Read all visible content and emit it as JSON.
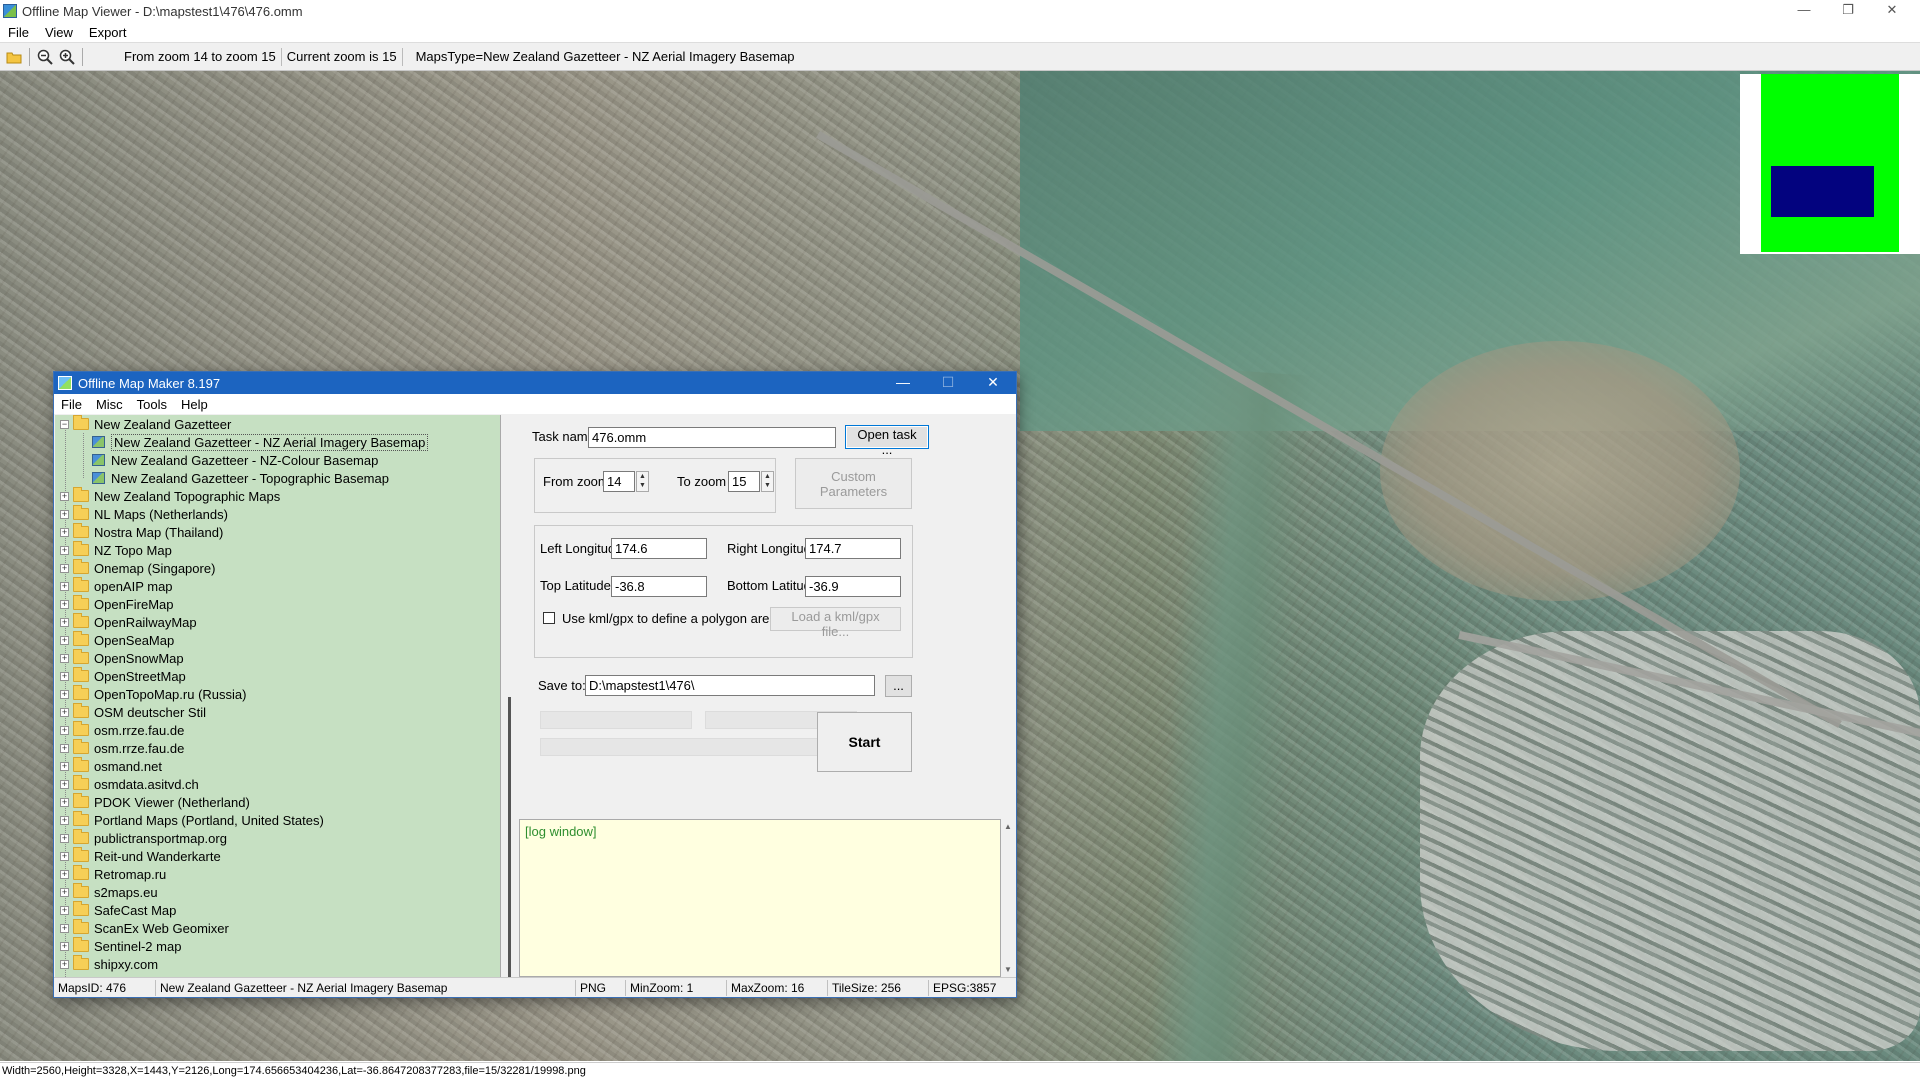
{
  "window": {
    "title": "Offline Map Viewer - D:\\mapstest1\\476\\476.omm",
    "controls": {
      "minimize": "—",
      "maximize": "❐",
      "close": "✕"
    }
  },
  "menu": [
    "File",
    "View",
    "Export"
  ],
  "toolbar": {
    "zoom_range": "From zoom 14 to zoom 15",
    "current_zoom": "Current zoom is 15",
    "maps_type": "MapsType=New Zealand Gazetteer - NZ Aerial Imagery Basemap",
    "icons": [
      "open-folder-icon",
      "zoom-out-icon",
      "zoom-in-icon"
    ]
  },
  "map": {
    "overview_colors": {
      "frame": "#00ff00",
      "viewport": "#03037f"
    }
  },
  "status_strip": "Width=2560,Height=3328,X=1443,Y=2126,Long=174.656653404236,Lat=-36.8647208377283,file=15/32281/19998.png",
  "dialog": {
    "title": "Offline Map Maker 8.197",
    "controls": {
      "minimize": "—",
      "maximize": "☐",
      "close": "✕"
    },
    "menu": [
      "File",
      "Misc",
      "Tools",
      "Help"
    ],
    "tree": {
      "root": "New Zealand Gazetteer",
      "children": [
        "New Zealand Gazetteer - NZ Aerial Imagery Basemap",
        "New Zealand Gazetteer - NZ-Colour Basemap",
        "New Zealand Gazetteer - Topographic Basemap"
      ],
      "selected_index": 0,
      "folders": [
        "New Zealand Topographic Maps",
        "NL Maps (Netherlands)",
        "Nostra Map (Thailand)",
        "NZ Topo Map",
        "Onemap (Singapore)",
        "openAIP map",
        "OpenFireMap",
        "OpenRailwayMap",
        "OpenSeaMap",
        "OpenSnowMap",
        "OpenStreetMap",
        "OpenTopoMap.ru (Russia)",
        "OSM deutscher Stil",
        "osm.rrze.fau.de",
        "osm.rrze.fau.de",
        "osmand.net",
        "osmdata.asitvd.ch",
        "PDOK Viewer (Netherland)",
        "Portland Maps (Portland, United States)",
        "publictransportmap.org",
        "Reit-und Wanderkarte",
        "Retromap.ru",
        "s2maps.eu",
        "SafeCast Map",
        "ScanEx Web Geomixer",
        "Sentinel-2 map",
        "shipxy.com"
      ]
    },
    "task": {
      "task_name_label": "Task name",
      "task_name_value": "476.omm",
      "open_task_button": "Open task ...",
      "from_zoom_label": "From zoom",
      "from_zoom_value": "14",
      "to_zoom_label": "To zoom",
      "to_zoom_value": "15",
      "custom_params_button": "Custom Parameters",
      "left_lon_label": "Left Longitude",
      "left_lon_value": "174.6",
      "right_lon_label": "Right Longitude",
      "right_lon_value": "174.7",
      "top_lat_label": "Top Latitude",
      "top_lat_value": "-36.8",
      "bottom_lat_label": "Bottom Latitude",
      "bottom_lat_value": "-36.9",
      "kml_checkbox_label": "Use kml/gpx to define a polygon area",
      "kml_checked": false,
      "load_kml_button": "Load a kml/gpx file...",
      "save_to_label": "Save to:",
      "save_to_value": "D:\\mapstest1\\476\\",
      "browse_button": "...",
      "start_button": "Start"
    },
    "log": {
      "text": "[log window]"
    },
    "status": {
      "maps_id": "MapsID: 476",
      "map_name": "New Zealand Gazetteer - NZ Aerial Imagery Basemap",
      "format": "PNG",
      "min_zoom": "MinZoom: 1",
      "max_zoom": "MaxZoom: 16",
      "tile_size": "TileSize: 256",
      "epsg": "EPSG:3857"
    }
  }
}
